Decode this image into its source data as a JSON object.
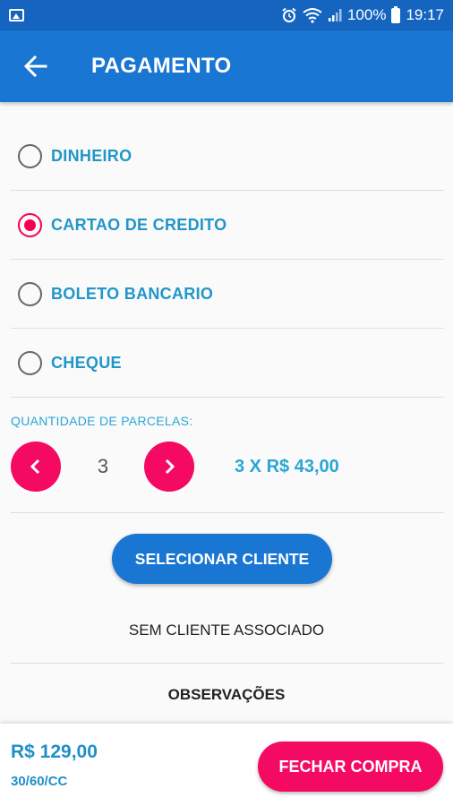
{
  "status_bar": {
    "battery_percent": "100%",
    "time": "19:17",
    "icons": [
      "image-icon",
      "alarm-icon",
      "wifi-icon",
      "signal-icon",
      "battery-icon"
    ]
  },
  "app_bar": {
    "title": "PAGAMENTO",
    "back_icon": "arrow-left-icon"
  },
  "payment_methods": {
    "selected": "CARTAO DE CREDITO",
    "options": [
      {
        "label": "DINHEIRO",
        "checked": false
      },
      {
        "label": "CARTAO DE CREDITO",
        "checked": true
      },
      {
        "label": "BOLETO BANCARIO",
        "checked": false
      },
      {
        "label": "CHEQUE",
        "checked": false
      }
    ]
  },
  "installments": {
    "label": "QUANTIDADE DE PARCELAS:",
    "quantity": "3",
    "value_text": "3 X R$ 43,00",
    "decrement_icon": "chevron-left-icon",
    "increment_icon": "chevron-right-icon"
  },
  "client": {
    "select_button": "SELECIONAR CLIENTE",
    "status": "SEM CLIENTE ASSOCIADO"
  },
  "observations": {
    "label": "OBSERVAÇÕES"
  },
  "footer": {
    "total": "R$ 129,00",
    "plan": "30/60/CC",
    "close_button": "FECHAR COMPRA"
  },
  "colors": {
    "primary": "#1976d2",
    "status_bar": "#1565c0",
    "accent": "#f50a63",
    "label_blue": "#2196c9"
  }
}
